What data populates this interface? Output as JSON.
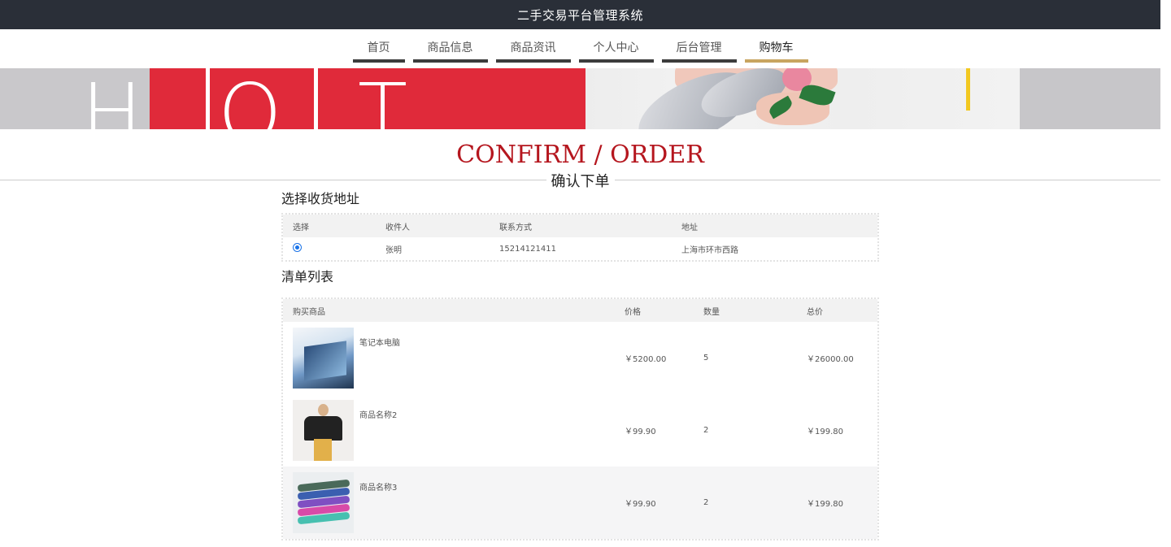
{
  "app": {
    "title": "二手交易平台管理系统"
  },
  "nav": {
    "items": [
      {
        "label": "首页"
      },
      {
        "label": "商品信息"
      },
      {
        "label": "商品资讯"
      },
      {
        "label": "个人中心"
      },
      {
        "label": "后台管理"
      },
      {
        "label": "购物车"
      }
    ],
    "active_index": 5,
    "accent_color": "#c8a560"
  },
  "banner": {
    "letters": [
      "H",
      "O",
      "T"
    ]
  },
  "heading": {
    "en": "CONFIRM / ORDER",
    "cn": "确认下单",
    "en_color": "#b5161e"
  },
  "address_section": {
    "title": "选择收货地址",
    "headers": [
      "选择",
      "收件人",
      "联系方式",
      "地址"
    ],
    "rows": [
      {
        "selected": true,
        "recipient": "张明",
        "phone": "15214121411",
        "address": "上海市环市西路"
      }
    ]
  },
  "list_section": {
    "title": "清单列表",
    "headers": [
      "购买商品",
      "价格",
      "数量",
      "总价"
    ],
    "rows": [
      {
        "name": "笔记本电脑",
        "price": "￥5200.00",
        "qty": "5",
        "total": "￥26000.00",
        "image": "laptop-image"
      },
      {
        "name": "商品名称2",
        "price": "￥99.90",
        "qty": "2",
        "total": "￥199.80",
        "image": "person-image"
      },
      {
        "name": "商品名称3",
        "price": "￥99.90",
        "qty": "2",
        "total": "￥199.80",
        "image": "resistance-bands-image"
      }
    ]
  }
}
